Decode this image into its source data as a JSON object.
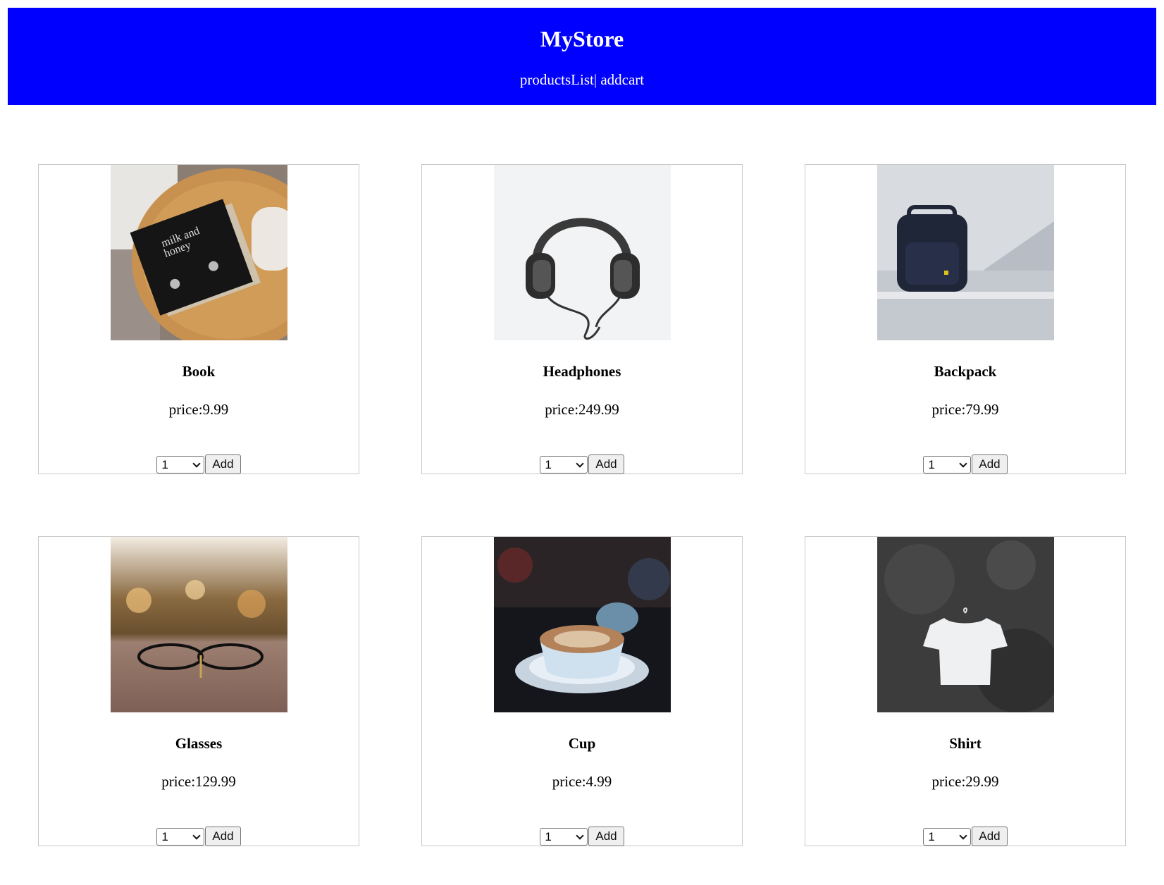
{
  "header": {
    "brand": "MyStore",
    "nav": {
      "products_label": "productsList",
      "separator": "|",
      "cart_label": "addcart"
    },
    "background_color": "#0000ff"
  },
  "products": [
    {
      "name": "Book",
      "price": "price:9.99",
      "quantity": "1",
      "add_label": "Add",
      "image": "book-photo"
    },
    {
      "name": "Headphones",
      "price": "price:249.99",
      "quantity": "1",
      "add_label": "Add",
      "image": "headphones-photo"
    },
    {
      "name": "Backpack",
      "price": "price:79.99",
      "quantity": "1",
      "add_label": "Add",
      "image": "backpack-photo"
    },
    {
      "name": "Glasses",
      "price": "price:129.99",
      "quantity": "1",
      "add_label": "Add",
      "image": "glasses-photo"
    },
    {
      "name": "Cup",
      "price": "price:4.99",
      "quantity": "1",
      "add_label": "Add",
      "image": "cup-photo"
    },
    {
      "name": "Shirt",
      "price": "price:29.99",
      "quantity": "1",
      "add_label": "Add",
      "image": "shirt-photo"
    }
  ],
  "icons": {
    "select_arrow": "chevron-down-icon"
  }
}
